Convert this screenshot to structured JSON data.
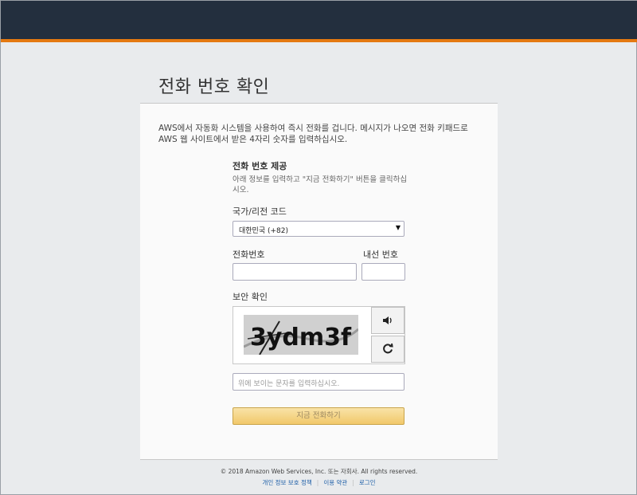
{
  "page": {
    "title": "전화 번호 확인",
    "intro_text": "AWS에서 자동화 시스템을 사용하여 즉시 전화를 겁니다. 메시지가 나오면 전화 키패드로 AWS 웹 사이트에서 받은 4자리 숫자를 입력하십시오."
  },
  "form": {
    "section_title": "전화 번호 제공",
    "section_desc": "아래 정보를 입력하고 \"지금 전화하기\" 버튼을 클릭하십시오.",
    "country_label": "국가/리전 코드",
    "country_value": "대한민국 (+82)",
    "phone_label": "전화번호",
    "phone_value": "",
    "extension_label": "내선 번호",
    "extension_value": "",
    "captcha_label": "보안 확인",
    "captcha_text": "3ydm3f",
    "captcha_placeholder": "위에 보이는 문자를 입력하십시오.",
    "call_button": "지금 전화하기"
  },
  "icons": {
    "audio": "speaker-icon",
    "refresh": "refresh-icon"
  },
  "colors": {
    "header_bg": "#232f3e",
    "header_accent": "#e47911",
    "button_bg": "#f1c86a",
    "link": "#1e5fa8"
  },
  "footer": {
    "copyright": "© 2018 Amazon Web Services, Inc. 또는 자회사. All rights reserved.",
    "links": [
      "개인 정보 보호 정책",
      "이용 약관",
      "로그인"
    ]
  }
}
